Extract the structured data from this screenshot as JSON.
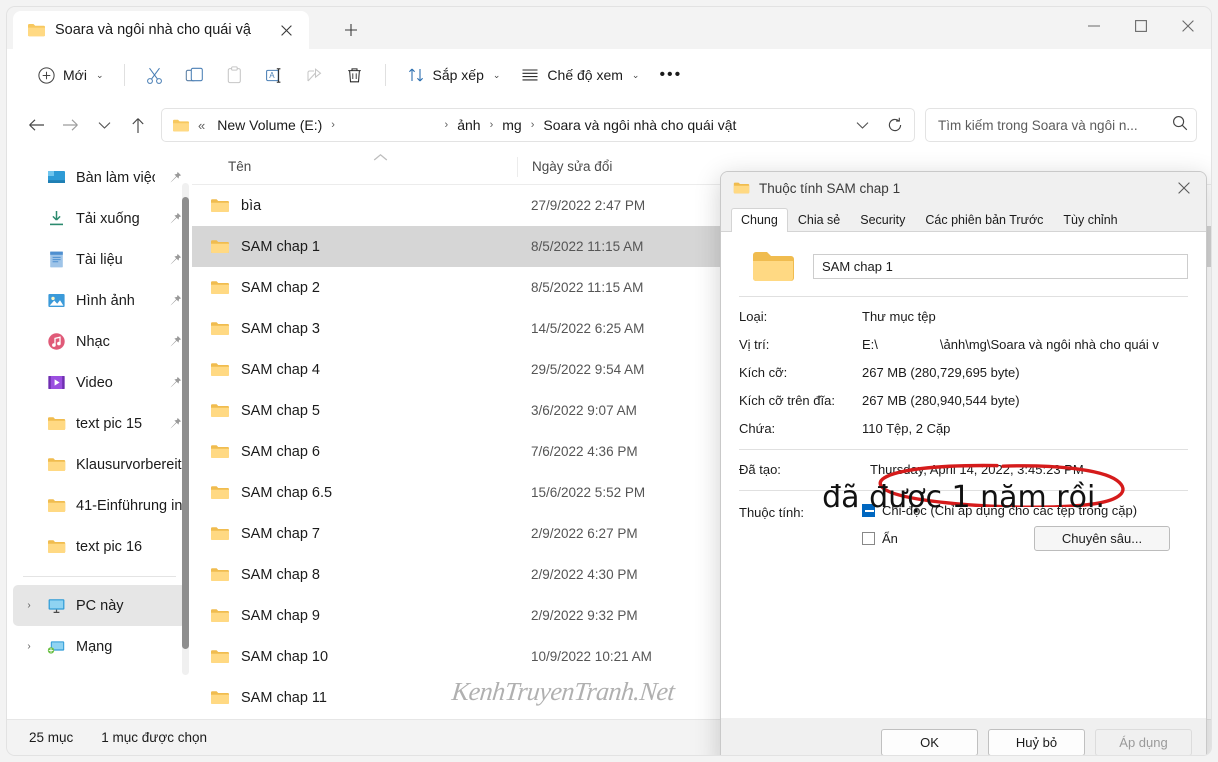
{
  "window": {
    "tab_title": "Soara và ngôi nhà cho quái vậ",
    "tab_close_icon": "close-icon",
    "new_tab_icon": "plus-icon",
    "minimize_icon": "minimize-icon",
    "maximize_icon": "maximize-icon",
    "close_icon": "close-icon"
  },
  "toolbar": {
    "new_label": "Mới",
    "new_icon": "plus-circle-icon",
    "cut_icon": "scissors-icon",
    "copy_icon": "copy-icon",
    "paste_icon": "paste-icon",
    "rename_icon": "rename-icon",
    "share_icon": "share-icon",
    "delete_icon": "trash-icon",
    "sort_label": "Sắp xếp",
    "sort_icon": "sort-arrows-icon",
    "view_label": "Chế độ xem",
    "view_icon": "lines-icon",
    "more_label": "•••",
    "chevron": "⌄"
  },
  "address": {
    "back_icon": "arrow-left-icon",
    "forward_icon": "arrow-right-icon",
    "recent_icon": "chevron-down-icon",
    "up_icon": "arrow-up-icon",
    "folder_icon": "folder-icon",
    "overflow": "«",
    "crumbs": [
      "New Volume (E:)",
      "ảnh",
      "mg",
      "Soara và ngôi nhà cho quái vật"
    ],
    "separator": "›",
    "dropdown_icon": "chevron-down-icon",
    "refresh_icon": "refresh-icon",
    "search_placeholder": "Tìm kiếm trong Soara và ngôi n...",
    "search_icon": "search-icon"
  },
  "sidebar": {
    "items": [
      {
        "label": "Bàn làm việc",
        "icon": "desktop-icon",
        "pinned": true,
        "expander": false
      },
      {
        "label": "Tải xuống",
        "icon": "download-icon",
        "pinned": true,
        "expander": false
      },
      {
        "label": "Tài liệu",
        "icon": "documents-icon",
        "pinned": true,
        "expander": false
      },
      {
        "label": "Hình ảnh",
        "icon": "pictures-icon",
        "pinned": true,
        "expander": false
      },
      {
        "label": "Nhạc",
        "icon": "music-icon",
        "pinned": true,
        "expander": false
      },
      {
        "label": "Video",
        "icon": "video-icon",
        "pinned": true,
        "expander": false
      },
      {
        "label": "text pic 15",
        "icon": "folder-icon",
        "pinned": true,
        "expander": false
      },
      {
        "label": "Klausurvorbereit",
        "icon": "folder-icon",
        "pinned": false,
        "expander": false
      },
      {
        "label": "41-Einführung in",
        "icon": "folder-icon",
        "pinned": false,
        "expander": false
      },
      {
        "label": "text pic 16",
        "icon": "folder-icon",
        "pinned": false,
        "expander": false
      }
    ],
    "bottom_items": [
      {
        "label": "PC này",
        "icon": "pc-icon",
        "selected": true,
        "expander": "›"
      },
      {
        "label": "Mạng",
        "icon": "network-icon",
        "selected": false,
        "expander": "›"
      }
    ]
  },
  "file_list": {
    "columns": {
      "name": "Tên",
      "date": "Ngày sửa đổi"
    },
    "sort_indicator": "^",
    "rows": [
      {
        "name": "bìa",
        "date": "27/9/2022 2:47 PM",
        "selected": false
      },
      {
        "name": "SAM chap 1",
        "date": "8/5/2022 11:15 AM",
        "selected": true
      },
      {
        "name": "SAM chap 2",
        "date": "8/5/2022 11:15 AM",
        "selected": false
      },
      {
        "name": "SAM chap 3",
        "date": "14/5/2022 6:25 AM",
        "selected": false
      },
      {
        "name": "SAM chap 4",
        "date": "29/5/2022 9:54 AM",
        "selected": false
      },
      {
        "name": "SAM chap 5",
        "date": "3/6/2022 9:07 AM",
        "selected": false
      },
      {
        "name": "SAM chap 6",
        "date": "7/6/2022 4:36 PM",
        "selected": false
      },
      {
        "name": "SAM chap 6.5",
        "date": "15/6/2022 5:52 PM",
        "selected": false
      },
      {
        "name": "SAM chap 7",
        "date": "2/9/2022 6:27 PM",
        "selected": false
      },
      {
        "name": "SAM chap 8",
        "date": "2/9/2022 4:30 PM",
        "selected": false
      },
      {
        "name": "SAM chap 9",
        "date": "2/9/2022 9:32 PM",
        "selected": false
      },
      {
        "name": "SAM chap 10",
        "date": "10/9/2022 10:21 AM",
        "selected": false
      },
      {
        "name": "SAM chap 11",
        "date": "",
        "selected": false
      }
    ],
    "watermark": "KenhTruyenTranh.Net"
  },
  "status": {
    "item_count": "25 mục",
    "selection": "1 mục được chọn"
  },
  "dialog": {
    "title": "Thuộc tính SAM chap 1",
    "title_icon": "folder-icon",
    "close_icon": "close-icon",
    "tabs": [
      {
        "label": "Chung",
        "active": true
      },
      {
        "label": "Chia sẻ",
        "active": false
      },
      {
        "label": "Security",
        "active": false
      },
      {
        "label": "Các phiên bản Trước",
        "active": false
      },
      {
        "label": "Tùy chỉnh",
        "active": false
      }
    ],
    "name_value": "SAM chap 1",
    "folder_icon": "folder-icon",
    "properties": [
      {
        "key": "Loại:",
        "value": "Thư mục tệp",
        "redacted": false
      },
      {
        "key": "Vị trí:",
        "value_prefix": "E:\\",
        "value_suffix": "\\ảnh\\mg\\Soara và ngôi nhà cho quái v",
        "redacted": true
      },
      {
        "key": "Kích cỡ:",
        "value": "267 MB (280,729,695 byte)",
        "redacted": false
      },
      {
        "key": "Kích cỡ trên đĩa:",
        "value": "267 MB (280,940,544 byte)",
        "redacted": false
      },
      {
        "key": "Chứa:",
        "value": "110 Tệp, 2 Cặp",
        "redacted": false
      }
    ],
    "created": {
      "key": "Đã tạo:",
      "value": "Thursday, April 14, 2022, 3:45:23 PM"
    },
    "attributes_key": "Thuộc tính:",
    "readonly_label": "Chỉ-đọc (Chỉ áp dụng cho các tệp trong cặp)",
    "readonly_state": "indeterminate",
    "hidden_label": "Ẩn",
    "hidden_state": "unchecked",
    "advanced_label": "Chuyên sâu...",
    "annotation_note": "đã được 1 năm rồi.",
    "annotation_color": "#d51b1b",
    "buttons": {
      "ok": "OK",
      "cancel": "Huỷ bỏ",
      "apply": "Áp dụng"
    }
  },
  "colors": {
    "accent": "#0067c0",
    "folder_yellow": "#f7c85f",
    "selection_gray": "#d6d6d6",
    "annotation_red": "#d51b1b"
  }
}
